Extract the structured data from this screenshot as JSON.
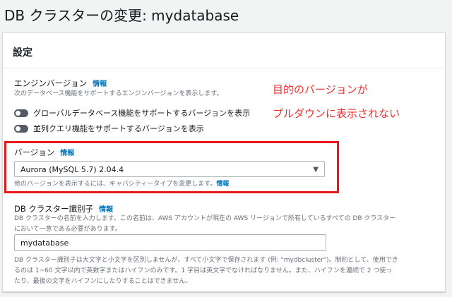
{
  "title": "DB クラスターの変更: mydatabase",
  "panel_title": "設定",
  "engine": {
    "label": "エンジンバージョン",
    "info": "情報",
    "desc": "次のデータベース機能をサポートするエンジンバージョンを表示します。",
    "toggles": [
      {
        "label": "グローバルデータベース機能をサポートするバージョンを表示",
        "on": false
      },
      {
        "label": "並列クエリ機能をサポートするバージョンを表示",
        "on": false
      }
    ]
  },
  "annotation": {
    "line1": "目的のバージョンが",
    "line2": "プルダウンに表示されない"
  },
  "version": {
    "label": "バージョン",
    "info": "情報",
    "value": "Aurora (MySQL 5.7) 2.04.4",
    "hint": "他のバージョンを表示するには、キャパシティータイプを変更します。",
    "hint_info": "情報"
  },
  "cluster": {
    "label": "DB クラスター識別子",
    "info": "情報",
    "desc1": "DB クラスターの名前を入力します。この名前は、AWS アカウントが現在の AWS リージョンで所有しているすべての DB クラスター",
    "desc2": "において一意である必要があります。",
    "value": "mydatabase",
    "hint1": "DB クラスター識別子は大文字と小文字を区別しませんが、すべて小文字で保存されます (例: \"mydbcluster\")。制約として、使用でき",
    "hint2": "るのは 1~60 文字以内で英数字またはハイフンのみです。1 字目は英文字でなければなりません。また、ハイフンを連続で 2 つ使っ",
    "hint3": "たり、最後の文字をハイフンにしたりすることはできません。"
  }
}
